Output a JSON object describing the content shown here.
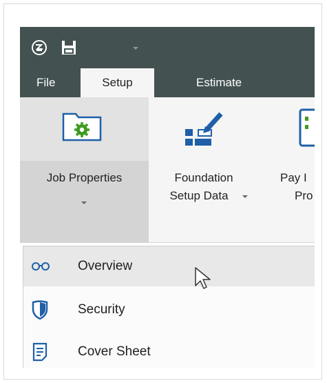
{
  "quick_access": {
    "icons": [
      "app-logo-icon",
      "save-icon",
      "customize-dropdown-icon"
    ]
  },
  "tabs": [
    {
      "label": "File",
      "active": false
    },
    {
      "label": "Setup",
      "active": true
    },
    {
      "label": "Estimate",
      "active": false
    }
  ],
  "ribbon": {
    "groups": [
      {
        "line1": "Job Properties",
        "line2": "",
        "icon": "folder-gear-icon",
        "has_dropdown": true
      },
      {
        "line1": "Foundation",
        "line2": "Setup Data",
        "icon": "foundation-setup-icon",
        "has_dropdown": true
      },
      {
        "line1": "Pay I",
        "line2": "Pro",
        "icon": "pay-items-icon",
        "has_dropdown": false
      }
    ]
  },
  "dropdown": {
    "items": [
      {
        "label": "Overview",
        "icon": "glasses-icon",
        "hovered": true
      },
      {
        "label": "Security",
        "icon": "shield-icon",
        "hovered": false
      },
      {
        "label": "Cover Sheet",
        "icon": "document-icon",
        "hovered": false
      }
    ]
  },
  "colors": {
    "title_bar": "#435151",
    "ribbon": "#f5f5f5",
    "accent_green": "#3f9b1e",
    "accent_blue": "#1f5fa8"
  }
}
